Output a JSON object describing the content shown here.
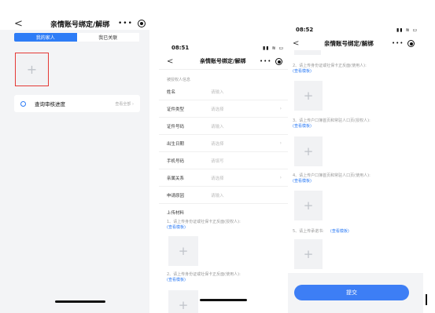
{
  "screen1": {
    "title": "亲情账号绑定/解绑",
    "back": "<",
    "menu_dots": "•••",
    "tabs": [
      "我的家人",
      "我已关联"
    ],
    "add_symbol": "+",
    "review": {
      "label": "查询审核进度",
      "link": "查看全部 ›"
    }
  },
  "screen2": {
    "time": "08:51",
    "signal": "▮▮ ≋ ▭",
    "title": "亲情账号绑定/解绑",
    "back": "<",
    "menu_dots": "•••",
    "section": "被授权人信息",
    "fields": [
      {
        "label": "姓名",
        "placeholder": "请输入",
        "arrow": ""
      },
      {
        "label": "证件类型",
        "placeholder": "请选择",
        "arrow": "›"
      },
      {
        "label": "证件号码",
        "placeholder": "请输入",
        "arrow": ""
      },
      {
        "label": "出生日期",
        "placeholder": "请选择",
        "arrow": "›"
      },
      {
        "label": "手机号码",
        "placeholder": "请填写",
        "arrow": ""
      },
      {
        "label": "亲属关系",
        "placeholder": "请选择",
        "arrow": "›"
      },
      {
        "label": "申请原因",
        "placeholder": "请输入",
        "arrow": ""
      }
    ],
    "upload_title": "上传材料",
    "uploads": [
      {
        "text": "1、请上传身份证或社保卡正反面(授权人):",
        "link": "(查看模板)"
      },
      {
        "text": "2、请上传身份证或社保卡正反面(使用人):",
        "link": "(查看模板)"
      }
    ],
    "add_symbol": "+"
  },
  "screen3": {
    "time": "08:52",
    "signal": "▮▮ ≋ ▭",
    "title": "亲情账号绑定/解绑",
    "back": "<",
    "menu_dots": "•••",
    "uploads": [
      {
        "text": "2、请上传身份证或社保卡正反面(使用人):",
        "link": "(查看模板)"
      },
      {
        "text": "3、请上传户口簿首页和常驻人口页(授权人):",
        "link": "(查看模板)"
      },
      {
        "text": "4、请上传户口簿首页和常驻人口页(使用人):",
        "link": "(查看模板)"
      },
      {
        "text": "5、请上传承诺书:",
        "link": "(查看模板)"
      }
    ],
    "add_symbol": "+",
    "submit": "提交"
  },
  "colors": {
    "accent": "#2d7cf6",
    "highlight": "#e53935",
    "placeholder": "#bdbdbd"
  }
}
